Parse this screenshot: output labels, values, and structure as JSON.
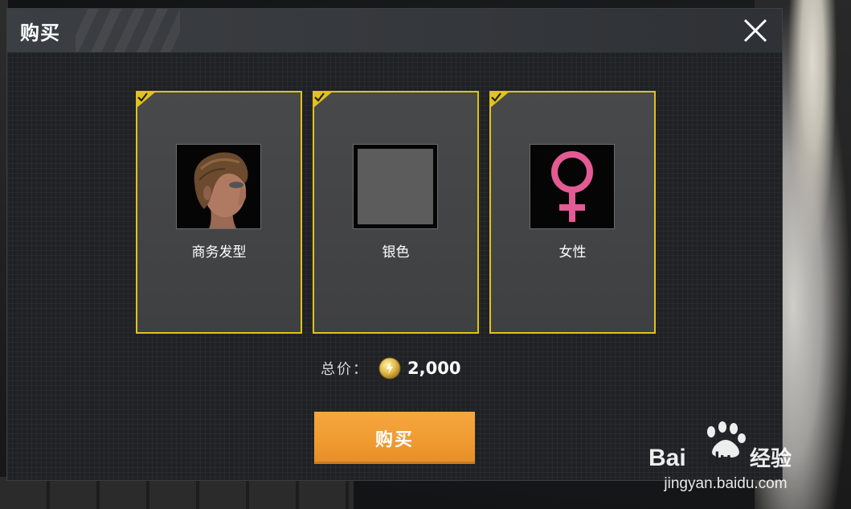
{
  "dialog": {
    "title": "购买",
    "close_icon": "close-icon"
  },
  "items": [
    {
      "label": "商务发型",
      "icon": "hairstyle-icon",
      "selected": true
    },
    {
      "label": "银色",
      "icon": "color-swatch-icon",
      "selected": true
    },
    {
      "label": "女性",
      "icon": "female-symbol-icon",
      "selected": true
    }
  ],
  "total": {
    "label": "总价：",
    "currency_icon": "coin-icon",
    "value": "2,000"
  },
  "buy_button": {
    "label": "购买"
  },
  "watermark": {
    "logo": "Baidu经验",
    "url": "jingyan.baidu.com"
  },
  "colors": {
    "selection_border": "#e2c21c",
    "buy_button": "#f19d33",
    "female_symbol": "#e45a94",
    "swatch": "#5c5c5c"
  }
}
